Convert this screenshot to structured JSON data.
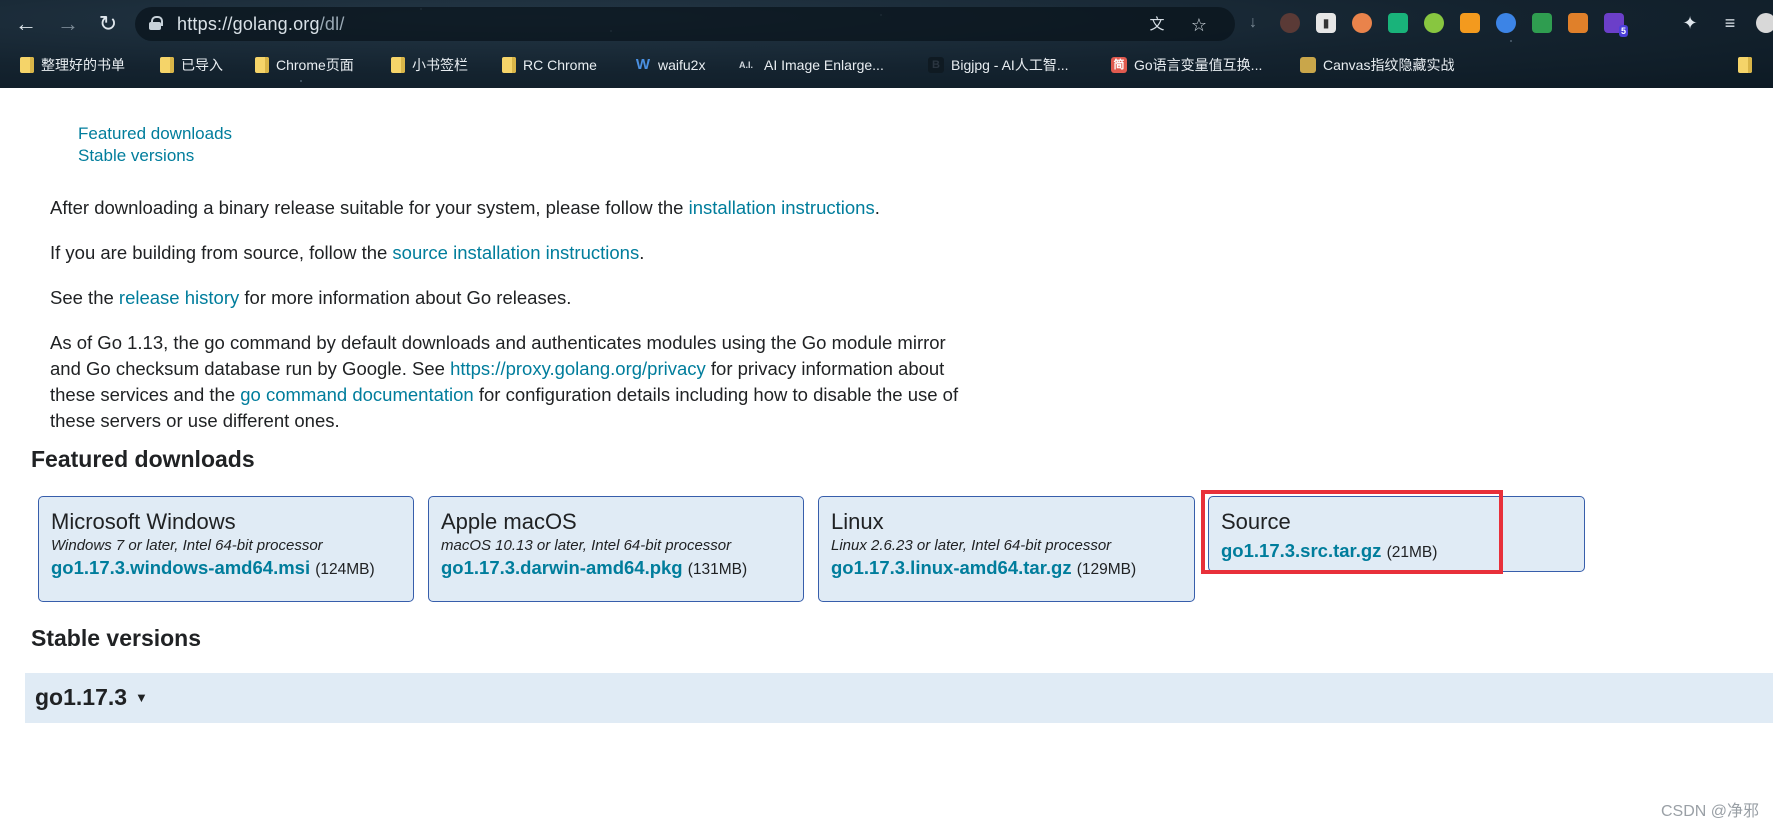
{
  "browser": {
    "url_host": "https://golang.org",
    "url_path": "/dl/",
    "bookmarks": [
      {
        "label": "整理好的书单",
        "type": "folder"
      },
      {
        "label": "已导入",
        "type": "folder"
      },
      {
        "label": "Chrome页面",
        "type": "folder"
      },
      {
        "label": "小书签栏",
        "type": "folder"
      },
      {
        "label": "RC Chrome",
        "type": "folder"
      },
      {
        "label": "waifu2x",
        "type": "site",
        "icon": "W",
        "color": "#3b82f6"
      },
      {
        "label": "AI Image Enlarge...",
        "type": "site",
        "icon": "A.I.",
        "color": "#111111"
      },
      {
        "label": "Bigjpg - AI人工智...",
        "type": "site",
        "icon": "B",
        "color": "#2b2b2b"
      },
      {
        "label": "Go语言变量值互换...",
        "type": "site",
        "icon": "简",
        "color": "#e05a4f"
      },
      {
        "label": "Canvas指纹隐藏实战",
        "type": "site",
        "icon": "C",
        "color": "#c9a64a"
      }
    ],
    "ext_badge": "5"
  },
  "toc": {
    "featured": "Featured downloads",
    "stable": "Stable versions"
  },
  "intro": {
    "p1_pre": "After downloading a binary release suitable for your system, please follow the ",
    "p1_link": "installation instructions",
    "p1_post": ".",
    "p2_pre": "If you are building from source, follow the ",
    "p2_link": "source installation instructions",
    "p2_post": ".",
    "p3_pre": "See the ",
    "p3_link": "release history",
    "p3_post": " for more information about Go releases.",
    "p4_a": "As of Go 1.13, the go command by default downloads and authenticates modules using the Go module mirror",
    "p4_b": "and Go checksum database run by Google. See ",
    "p4_link1": "https://proxy.golang.org/privacy",
    "p4_c": " for privacy information about",
    "p4_d": "these services and the ",
    "p4_link2": "go command documentation",
    "p4_e": " for configuration details including how to disable the use of",
    "p4_f": "these servers or use different ones."
  },
  "featured": {
    "heading": "Featured downloads",
    "cards": [
      {
        "title": "Microsoft Windows",
        "sub": "Windows 7 or later, Intel 64-bit processor",
        "file": "go1.17.3.windows-amd64.msi",
        "size": "(124MB)"
      },
      {
        "title": "Apple macOS",
        "sub": "macOS 10.13 or later, Intel 64-bit processor",
        "file": "go1.17.3.darwin-amd64.pkg",
        "size": "(131MB)"
      },
      {
        "title": "Linux",
        "sub": "Linux 2.6.23 or later, Intel 64-bit processor",
        "file": "go1.17.3.linux-amd64.tar.gz",
        "size": "(129MB)"
      },
      {
        "title": "Source",
        "sub": "",
        "file": "go1.17.3.src.tar.gz",
        "size": "(21MB)"
      }
    ]
  },
  "stable": {
    "heading": "Stable versions",
    "version": "go1.17.3",
    "caret": "▼"
  },
  "watermark": "CSDN @净邪",
  "colors": {
    "link": "#007d9c",
    "card_bg": "#e0ebf5",
    "card_border": "#375eab",
    "highlight": "#e8303a"
  }
}
